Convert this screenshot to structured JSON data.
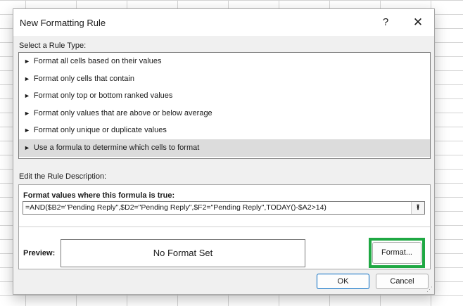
{
  "dialog": {
    "title": "New Formatting Rule",
    "help_label": "?",
    "close_label": "✕"
  },
  "rule_type": {
    "label": "Select a Rule Type:",
    "items": [
      {
        "label": "Format all cells based on their values"
      },
      {
        "label": "Format only cells that contain"
      },
      {
        "label": "Format only top or bottom ranked values"
      },
      {
        "label": "Format only values that are above or below average"
      },
      {
        "label": "Format only unique or duplicate values"
      },
      {
        "label": "Use a formula to determine which cells to format"
      }
    ],
    "selected_index": 5,
    "bullet": "►"
  },
  "description": {
    "label": "Edit the Rule Description:",
    "formula_label": "Format values where this formula is true:",
    "formula_value": "=AND($B2=\"Pending Reply\",$D2=\"Pending Reply\",$F2=\"Pending Reply\",TODAY()-$A2>14)",
    "collapse_icon": "⭱",
    "preview_label": "Preview:",
    "preview_text": "No Format Set",
    "format_button": "Format..."
  },
  "buttons": {
    "ok": "OK",
    "cancel": "Cancel"
  },
  "colors": {
    "highlight": "#1fa843",
    "selected_row": "#dcdcdc",
    "ok_border": "#0067c0"
  }
}
